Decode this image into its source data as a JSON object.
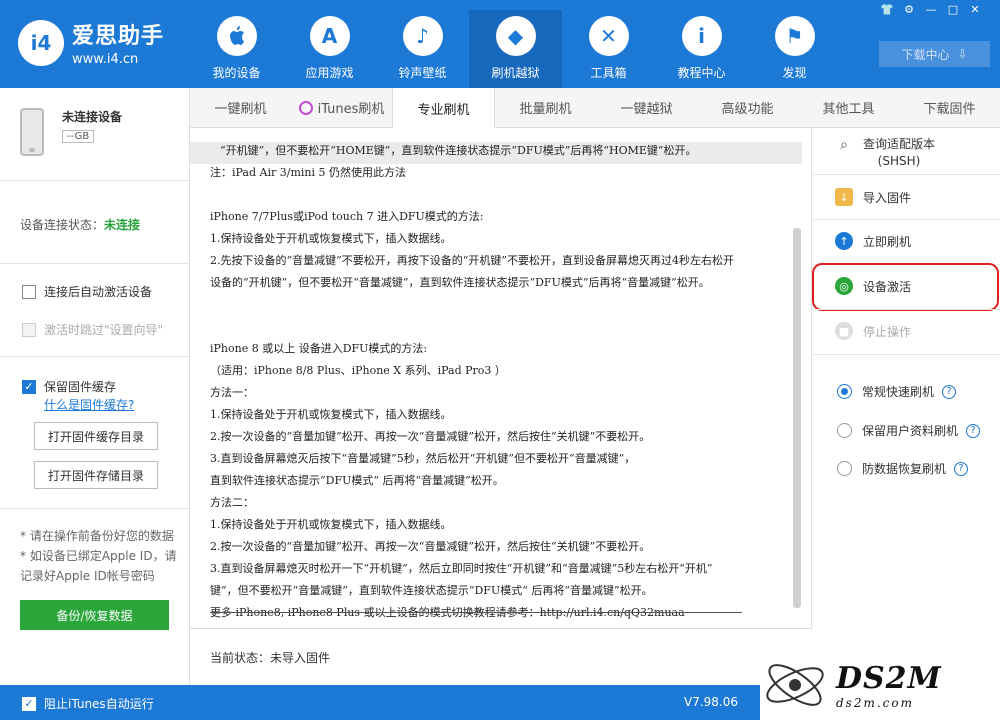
{
  "app": {
    "name": "爱思助手",
    "url": "www.i4.cn",
    "logo_mark": "i4"
  },
  "nav": [
    {
      "label": "我的设备",
      "icon": "apple-icon",
      "glyph": ""
    },
    {
      "label": "应用游戏",
      "icon": "appstore-icon",
      "glyph": "A"
    },
    {
      "label": "铃声壁纸",
      "icon": "music-icon",
      "glyph": "♪"
    },
    {
      "label": "刷机越狱",
      "icon": "dropbox-icon",
      "glyph": "◆"
    },
    {
      "label": "工具箱",
      "icon": "tools-icon",
      "glyph": "✕"
    },
    {
      "label": "教程中心",
      "icon": "info-icon",
      "glyph": "i"
    },
    {
      "label": "发现",
      "icon": "flag-icon",
      "glyph": "⚑"
    }
  ],
  "window_controls": [
    "👕",
    "⚙",
    "—",
    "□",
    "✕"
  ],
  "download_center": {
    "label": "下载中心",
    "icon": "⇩"
  },
  "device": {
    "name": "未连接设备",
    "capacity": "--GB"
  },
  "connection": {
    "label": "设备连接状态：",
    "value": "未连接"
  },
  "left_options": {
    "auto_activate": "连接后自动激活设备",
    "skip_setup": "激活时跳过\"设置向导\"",
    "keep_cache": "保留固件缓存",
    "cache_link": "什么是固件缓存?",
    "open_cache_dir": "打开固件缓存目录",
    "open_store_dir": "打开固件存储目录",
    "note1": "* 请在操作前备份好您的数据",
    "note2": "* 如设备已绑定Apple ID，请记录好Apple ID帐号密码",
    "backup_btn": "备份/恢复数据"
  },
  "tabs": [
    "一键刷机",
    "iTunes刷机",
    "专业刷机",
    "批量刷机",
    "一键越狱",
    "高级功能",
    "其他工具",
    "下载固件"
  ],
  "active_tab": 2,
  "content_lines": [
    "“开机键”，但不要松开“HOME键”，直到软件连接状态提示“DFU模式”后再将“HOME键”松开。",
    "注：iPad Air 3/mini 5 仍然使用此方法",
    "",
    "iPhone 7/7Plus或iPod touch 7 进入DFU模式的方法:",
    "1.保持设备处于开机或恢复模式下，插入数据线。",
    "2.先按下设备的“音量减键”不要松开，再按下设备的“开机键”不要松开，直到设备屏幕熄灭再过4秒左右松开",
    "  设备的“开机键”，但不要松开“音量减键”，直到软件连接状态提示“DFU模式”后再将“音量减键”松开。",
    "",
    "",
    "iPhone 8 或以上 设备进入DFU模式的方法:",
    "（适用：iPhone 8/8 Plus、iPhone X 系列、iPad Pro3 ）",
    "方法一：",
    "1.保持设备处于开机或恢复模式下，插入数据线。",
    "2.按一次设备的“音量加键”松开、再按一次“音量减键”松开，然后按住“关机键”不要松开。",
    "3.直到设备屏幕熄灭后按下“音量减键”5秒，然后松开“开机键”但不要松开“音量减键”，",
    "直到软件连接状态提示“DFU模式“ 后再将“音量减键”松开。",
    "方法二：",
    "1.保持设备处于开机或恢复模式下，插入数据线。",
    "2.按一次设备的“音量加键”松开、再按一次“音量减键”松开，然后按住“关机键”不要松开。",
    "3.直到设备屏幕熄灭时松开一下“开机键”，然后立即同时按住“开机键”和“音量减键”5秒左右松开“开机”",
    "  键”，但不要松开“音量减键”，直到软件连接状态提示“DFU模式“ 后再将“音量减键”松开。",
    "更多 iPhone8, iPhone8 Plus 或以上设备的模式切换教程请参考：http://url.i4.cn/qQ32muaa"
  ],
  "status": {
    "label": "当前状态：",
    "value": "未导入固件"
  },
  "right_actions": {
    "query_shsh": "查询适配版本",
    "query_shsh2": "(SHSH)",
    "import_fw": "导入固件",
    "flash_now": "立即刷机",
    "activate": "设备激活",
    "stop": "停止操作"
  },
  "flash_modes": [
    {
      "label": "常规快速刷机",
      "selected": true
    },
    {
      "label": "保留用户资料刷机",
      "selected": false
    },
    {
      "label": "防数据恢复刷机",
      "selected": false
    }
  ],
  "bottom": {
    "block_itunes": "阻止iTunes自动运行",
    "version": "V7.98.06"
  },
  "watermark": {
    "big": "DS2M",
    "small": "ds2m.com"
  },
  "colors": {
    "brand": "#1d79d6",
    "green": "#2aa63a",
    "highlight": "#e02020"
  }
}
